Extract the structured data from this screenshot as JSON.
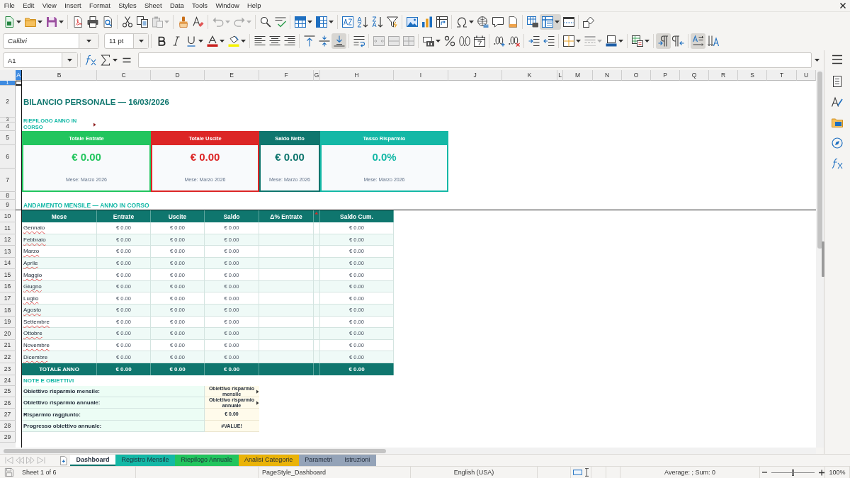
{
  "menu_bar": [
    "File",
    "Edit",
    "View",
    "Insert",
    "Format",
    "Styles",
    "Sheet",
    "Data",
    "Tools",
    "Window",
    "Help"
  ],
  "standard_toolbar": {
    "freeze_on": true
  },
  "formatting_toolbar": {
    "font_name": "Calibri",
    "font_size": "11 pt",
    "align_bottom_on": true,
    "left_to_right_on": true,
    "horizontal_text_on": true
  },
  "formula_bar": {
    "name_box": "A1"
  },
  "sheet": {
    "column_headers": [
      {
        "label": "A",
        "selected": true
      },
      {
        "label": "B",
        "selected": false
      },
      {
        "label": "C",
        "selected": false
      },
      {
        "label": "D",
        "selected": false
      },
      {
        "label": "E",
        "selected": false
      },
      {
        "label": "F",
        "selected": false
      },
      {
        "label": "G",
        "selected": false
      },
      {
        "label": "H",
        "selected": false
      },
      {
        "label": "I",
        "selected": false
      },
      {
        "label": "J",
        "selected": false
      },
      {
        "label": "K",
        "selected": false
      },
      {
        "label": "L",
        "selected": false
      },
      {
        "label": "M",
        "selected": false
      },
      {
        "label": "N",
        "selected": false
      },
      {
        "label": "O",
        "selected": false
      },
      {
        "label": "P",
        "selected": false
      },
      {
        "label": "Q",
        "selected": false
      },
      {
        "label": "R",
        "selected": false
      },
      {
        "label": "S",
        "selected": false
      },
      {
        "label": "T",
        "selected": false
      },
      {
        "label": "U",
        "selected": false
      }
    ],
    "row_headers": [
      {
        "label": "1",
        "selected": true
      },
      {
        "label": "2",
        "selected": false
      },
      {
        "label": "3",
        "selected": false
      },
      {
        "label": "4",
        "selected": false
      },
      {
        "label": "5",
        "selected": false
      },
      {
        "label": "6",
        "selected": false
      },
      {
        "label": "7",
        "selected": false
      },
      {
        "label": "8",
        "selected": false
      },
      {
        "label": "9",
        "selected": false
      },
      {
        "label": "10",
        "selected": false
      },
      {
        "label": "11",
        "selected": false
      },
      {
        "label": "12",
        "selected": false
      },
      {
        "label": "13",
        "selected": false
      },
      {
        "label": "14",
        "selected": false
      },
      {
        "label": "15",
        "selected": false
      },
      {
        "label": "16",
        "selected": false
      },
      {
        "label": "17",
        "selected": false
      },
      {
        "label": "18",
        "selected": false
      },
      {
        "label": "19",
        "selected": false
      },
      {
        "label": "20",
        "selected": false
      },
      {
        "label": "21",
        "selected": false
      },
      {
        "label": "22",
        "selected": false
      },
      {
        "label": "23",
        "selected": false
      },
      {
        "label": "24",
        "selected": false
      },
      {
        "label": "25",
        "selected": false
      },
      {
        "label": "26",
        "selected": false
      },
      {
        "label": "27",
        "selected": false
      },
      {
        "label": "28",
        "selected": false
      },
      {
        "label": "29",
        "selected": false
      }
    ],
    "title": "BILANCIO PERSONALE — 16/03/2026",
    "summary_heading": {
      "text": "RIEPILOGO ANNO IN CORSO",
      "clipped": true
    },
    "kpi_cards": [
      {
        "label": "Totale Entrate",
        "value": "€ 0.00",
        "note": "Mese: Marzo 2026",
        "color": "#22c55e"
      },
      {
        "label": "Totale Uscite",
        "value": "€ 0.00",
        "note": "Mese: Marzo 2026",
        "color": "#dc2626"
      },
      {
        "label": "Saldo Netto",
        "value": "€ 0.00",
        "note": "Mese: Marzo 2026",
        "color": "#0f766e"
      },
      {
        "label": "Tasso Risparmio",
        "value": "0.0%",
        "note": "Mese: Marzo 2026",
        "color": "#14b8a6"
      }
    ],
    "trend_heading": "ANDAMENTO MENSILE — ANNO IN CORSO",
    "monthly_table": {
      "columns": [
        "Mese",
        "Entrate",
        "Uscite",
        "Saldo",
        "Δ% Entrate",
        "Saldo Cum."
      ],
      "narrow_column": {
        "clipped": true
      },
      "rows": [
        {
          "mese": "Gennaio",
          "entrate": "€ 0.00",
          "uscite": "€ 0.00",
          "saldo": "€ 0.00",
          "saldo_cum": "€ 0.00"
        },
        {
          "mese": "Febbraio",
          "entrate": "€ 0.00",
          "uscite": "€ 0.00",
          "saldo": "€ 0.00",
          "saldo_cum": "€ 0.00"
        },
        {
          "mese": "Marzo",
          "entrate": "€ 0.00",
          "uscite": "€ 0.00",
          "saldo": "€ 0.00",
          "saldo_cum": "€ 0.00"
        },
        {
          "mese": "Aprile",
          "entrate": "€ 0.00",
          "uscite": "€ 0.00",
          "saldo": "€ 0.00",
          "saldo_cum": "€ 0.00"
        },
        {
          "mese": "Maggio",
          "entrate": "€ 0.00",
          "uscite": "€ 0.00",
          "saldo": "€ 0.00",
          "saldo_cum": "€ 0.00"
        },
        {
          "mese": "Giugno",
          "entrate": "€ 0.00",
          "uscite": "€ 0.00",
          "saldo": "€ 0.00",
          "saldo_cum": "€ 0.00"
        },
        {
          "mese": "Luglio",
          "entrate": "€ 0.00",
          "uscite": "€ 0.00",
          "saldo": "€ 0.00",
          "saldo_cum": "€ 0.00"
        },
        {
          "mese": "Agosto",
          "entrate": "€ 0.00",
          "uscite": "€ 0.00",
          "saldo": "€ 0.00",
          "saldo_cum": "€ 0.00"
        },
        {
          "mese": "Settembre",
          "entrate": "€ 0.00",
          "uscite": "€ 0.00",
          "saldo": "€ 0.00",
          "saldo_cum": "€ 0.00"
        },
        {
          "mese": "Ottobre",
          "entrate": "€ 0.00",
          "uscite": "€ 0.00",
          "saldo": "€ 0.00",
          "saldo_cum": "€ 0.00"
        },
        {
          "mese": "Novembre",
          "entrate": "€ 0.00",
          "uscite": "€ 0.00",
          "saldo": "€ 0.00",
          "saldo_cum": "€ 0.00"
        },
        {
          "mese": "Dicembre",
          "entrate": "€ 0.00",
          "uscite": "€ 0.00",
          "saldo": "€ 0.00",
          "saldo_cum": "€ 0.00"
        }
      ],
      "total_row": {
        "mese": "TOTALE ANNO",
        "entrate": "€ 0.00",
        "uscite": "€ 0.00",
        "saldo": "€ 0.00",
        "saldo_cum": "€ 0.00"
      }
    },
    "notes_heading": "NOTE E OBIETTIVI",
    "notes": [
      {
        "label": "Obiettivo risparmio mensile:",
        "value": "Obiettivo risparmio mensile",
        "clipped": true
      },
      {
        "label": "Obiettivo risparmio annuale:",
        "value": "Obiettivo risparmio annuale",
        "clipped": true
      },
      {
        "label": "Risparmio raggiunto:",
        "value": "€ 0.00",
        "clipped": false
      },
      {
        "label": "Progresso obiettivo annuale:",
        "value": "#VALUE!",
        "clipped": false
      }
    ]
  },
  "sheet_tabs": [
    {
      "label": "Dashboard",
      "selected": true,
      "color": "#0f766e"
    },
    {
      "label": "Registro Mensile",
      "selected": false,
      "color": "#14b8a6"
    },
    {
      "label": "Riepilogo Annuale",
      "selected": false,
      "color": "#22c55e"
    },
    {
      "label": "Analisi Categorie",
      "selected": false,
      "color": "#eab308"
    },
    {
      "label": "Parametri",
      "selected": false,
      "color": "#94a3b8"
    },
    {
      "label": "Istruzioni",
      "selected": false,
      "color": "#94a3b8"
    }
  ],
  "status_bar": {
    "sheet_position": "Sheet 1 of 6",
    "page_style": "PageStyle_Dashboard",
    "language": "English (USA)",
    "selection_summary": "Average: ; Sum: 0",
    "zoom_slider": {
      "level": 0.5
    },
    "zoom_percent": "100%"
  }
}
